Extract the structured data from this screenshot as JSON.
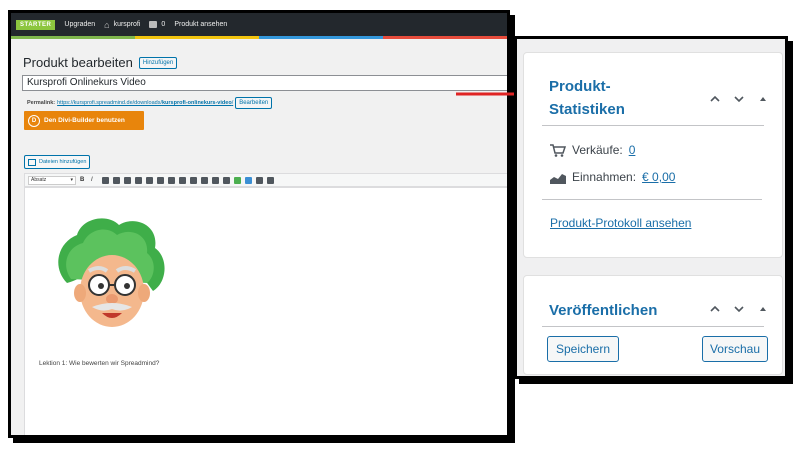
{
  "admin_bar": {
    "badge": "STARTER",
    "upgrade": "Upgraden",
    "site": "kursprofi",
    "comments": "0",
    "view_product": "Produkt ansehen"
  },
  "editor": {
    "page_title": "Produkt bearbeiten",
    "add_new": "Hinzufügen",
    "title_value": "Kursprofi Onlinekurs Video",
    "permalink_label": "Permalink:",
    "permalink_url": "https://kursprofi.spreadmind.de/downloads/",
    "permalink_slug": "kursprofi-onlinekurs-video",
    "permalink_slash": "/",
    "edit_button": "Bearbeiten",
    "divi_button": "Den Divi-Builder benutzen",
    "divi_letter": "D",
    "add_media": "Dateien hinzufügen",
    "format_select": "Absatz",
    "content_text": "Lektion 1: Wie bewerten wir Spreadmind?"
  },
  "stats_widget": {
    "title": "Produkt-Statistiken",
    "sales_label": "Verkäufe:",
    "sales_value": "0",
    "earnings_label": "Einnahmen:",
    "earnings_value": "€ 0,00",
    "log_link": "Produkt-Protokoll ansehen"
  },
  "publish_widget": {
    "title": "Veröffentlichen",
    "save": "Speichern",
    "preview": "Vorschau"
  },
  "colors": {
    "accent": "#1a6ea8",
    "arrow": "#e02424",
    "divi_orange": "#e8850c",
    "starter_green": "#8dc63f"
  }
}
